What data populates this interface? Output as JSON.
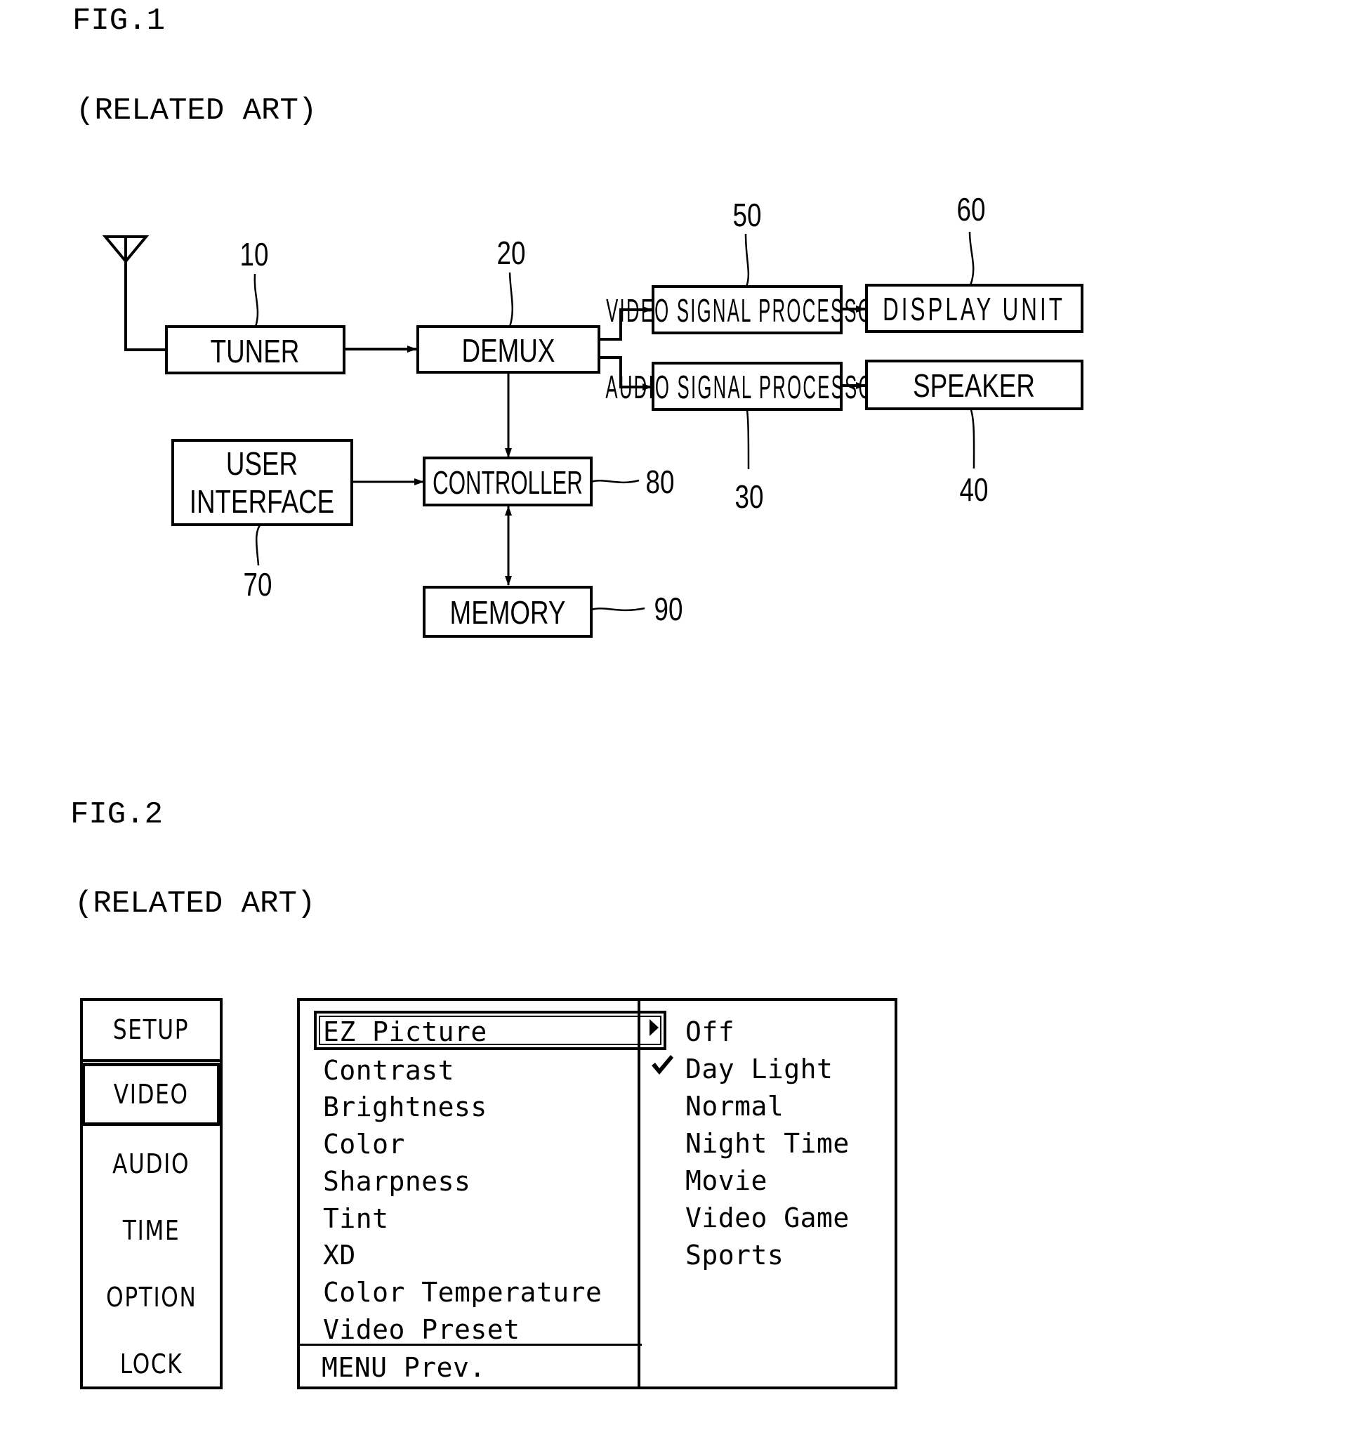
{
  "figure1": {
    "title": "FIG.1",
    "subtitle": "(RELATED ART)",
    "blocks": {
      "tuner": {
        "label": "TUNER",
        "ref": "10"
      },
      "demux": {
        "label": "DEMUX",
        "ref": "20"
      },
      "audio_signal_processor": {
        "label": "AUDIO SIGNAL PROCESSOR",
        "ref": "30"
      },
      "speaker": {
        "label": "SPEAKER",
        "ref": "40"
      },
      "video_signal_processor": {
        "label": "VIDEO SIGNAL PROCESSOR",
        "ref": "50"
      },
      "display_unit": {
        "label": "DISPLAY UNIT",
        "ref": "60"
      },
      "user_interface": {
        "label_line1": "USER",
        "label_line2": "INTERFACE",
        "ref": "70"
      },
      "controller": {
        "label": "CONTROLLER",
        "ref": "80"
      },
      "memory": {
        "label": "MEMORY",
        "ref": "90"
      }
    },
    "antenna_icon": "antenna-icon"
  },
  "figure2": {
    "title": "FIG.2",
    "subtitle": "(RELATED ART)",
    "categories": [
      {
        "label": "SETUP"
      },
      {
        "label": "VIDEO",
        "selected": true
      },
      {
        "label": "AUDIO"
      },
      {
        "label": "TIME"
      },
      {
        "label": "OPTION"
      },
      {
        "label": "LOCK"
      }
    ],
    "video_menu": [
      {
        "label": "EZ Picture",
        "highlighted": true,
        "has_submenu": true
      },
      {
        "label": "Contrast"
      },
      {
        "label": "Brightness"
      },
      {
        "label": "Color"
      },
      {
        "label": "Sharpness"
      },
      {
        "label": "Tint"
      },
      {
        "label": "XD"
      },
      {
        "label": "Color Temperature"
      },
      {
        "label": "Video Preset"
      }
    ],
    "footer": "MENU Prev.",
    "ez_picture_options": [
      {
        "label": "Off"
      },
      {
        "label": "Day Light",
        "checked": true
      },
      {
        "label": "Normal"
      },
      {
        "label": "Night Time"
      },
      {
        "label": "Movie"
      },
      {
        "label": "Video Game"
      },
      {
        "label": "Sports"
      }
    ]
  }
}
